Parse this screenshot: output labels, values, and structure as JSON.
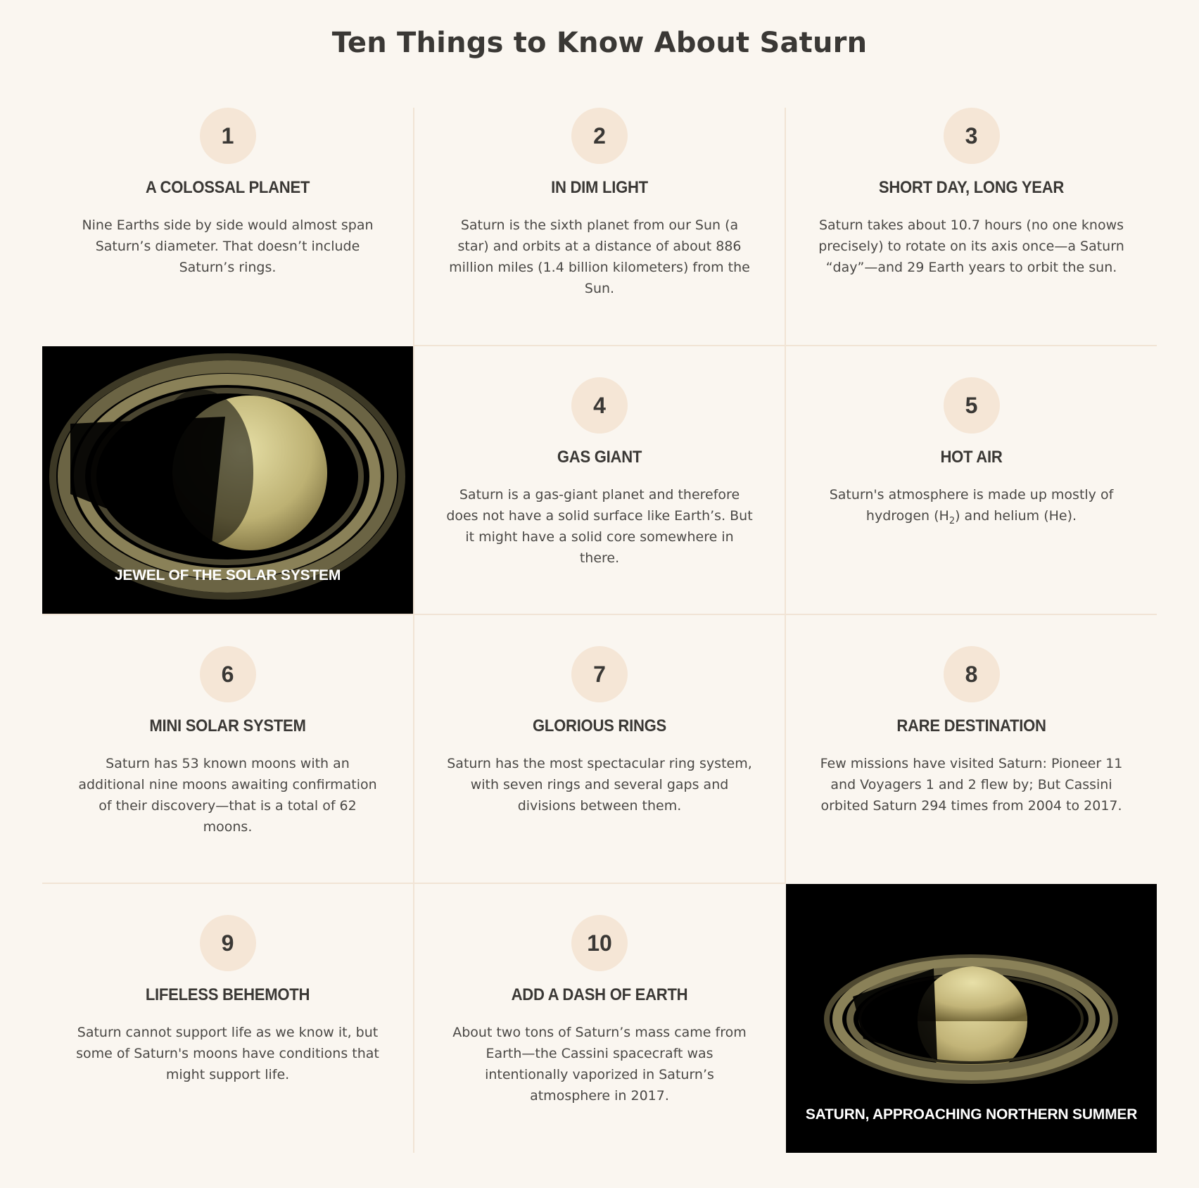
{
  "page": {
    "title": "Ten Things to Know About Saturn"
  },
  "facts": [
    {
      "num": "1",
      "title": "A COLOSSAL PLANET",
      "body": "Nine Earths side by side would almost span Saturn’s diameter. That doesn’t include Saturn’s rings."
    },
    {
      "num": "2",
      "title": "IN DIM LIGHT",
      "body": "Saturn is the sixth planet from our Sun (a star) and orbits at a distance of about 886 million miles (1.4 billion kilometers) from the Sun."
    },
    {
      "num": "3",
      "title": "SHORT DAY, LONG YEAR",
      "body": "Saturn takes about 10.7 hours (no one knows precisely) to rotate on its axis once—a Saturn “day”—and 29 Earth years to orbit the sun."
    },
    {
      "num": "4",
      "title": "GAS GIANT",
      "body": "Saturn is a gas-giant planet and therefore does not have a solid surface like Earth’s. But it might have a solid core somewhere in there."
    },
    {
      "num": "5",
      "title": "HOT AIR",
      "body_pre": "Saturn's atmosphere is made up mostly of hydrogen (H",
      "body_sub": "2",
      "body_post": ") and helium (He)."
    },
    {
      "num": "6",
      "title": "MINI SOLAR SYSTEM",
      "body": "Saturn has 53 known moons with an additional nine moons awaiting confirmation of their discovery—that is a total of 62 moons."
    },
    {
      "num": "7",
      "title": "GLORIOUS RINGS",
      "body": "Saturn has the most spectacular ring system, with seven rings and several gaps and divisions between them."
    },
    {
      "num": "8",
      "title": "RARE DESTINATION",
      "body": "Few missions have visited Saturn: Pioneer 11 and Voyagers 1 and 2 flew by; But Cassini orbited Saturn 294 times from 2004 to 2017."
    },
    {
      "num": "9",
      "title": "LIFELESS BEHEMOTH",
      "body": "Saturn cannot support life as we know it, but some of Saturn's moons have conditions that might support life."
    },
    {
      "num": "10",
      "title": "ADD A DASH OF EARTH",
      "body": "About two tons of Saturn’s mass came from Earth—the Cassini spacecraft was intentionally vaporized in Saturn’s atmosphere in 2017."
    }
  ],
  "images": [
    {
      "caption": "JEWEL OF THE SOLAR SYSTEM"
    },
    {
      "caption": "SATURN, APPROACHING NORTHERN SUMMER"
    }
  ],
  "colors": {
    "background": "#faf6f0",
    "circle": "#f5e6d6",
    "divider": "#f1e4d5",
    "text": "#3a3835"
  }
}
